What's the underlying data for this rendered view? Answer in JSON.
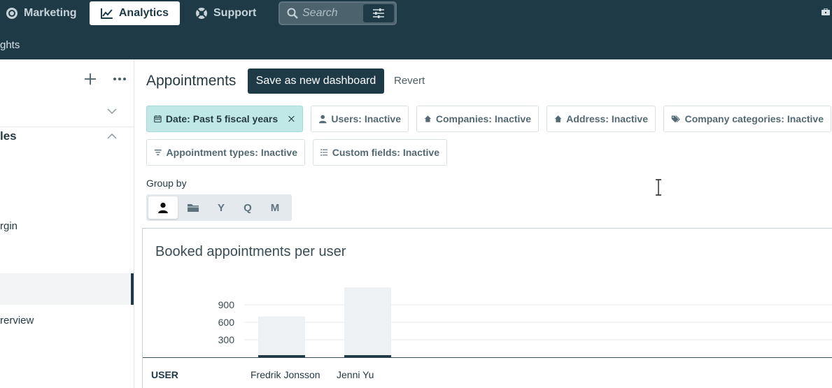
{
  "topnav": {
    "tabs": [
      {
        "label": "Marketing",
        "icon": "target-icon",
        "active": false
      },
      {
        "label": "Analytics",
        "icon": "line-chart-icon",
        "active": true
      },
      {
        "label": "Support",
        "icon": "lifebuoy-icon",
        "active": false
      }
    ],
    "search": {
      "placeholder": "Search",
      "value": ""
    },
    "subnav_label": "ghts"
  },
  "sidebar": {
    "section_title": "les",
    "items": [
      {
        "label": "rgin"
      },
      {
        "label": ""
      },
      {
        "label": "rerview"
      }
    ]
  },
  "main": {
    "title": "Appointments",
    "save_label": "Save as new dashboard",
    "revert_label": "Revert",
    "filters": [
      {
        "label": "Date: Past 5 fiscal years",
        "icon": "calendar-icon",
        "active": true
      },
      {
        "label": "Users: Inactive",
        "icon": "user-icon",
        "active": false
      },
      {
        "label": "Companies: Inactive",
        "icon": "home-icon",
        "active": false
      },
      {
        "label": "Address: Inactive",
        "icon": "home-icon",
        "active": false
      },
      {
        "label": "Company categories: Inactive",
        "icon": "tags-icon",
        "active": false
      },
      {
        "label": "Appointment types: Inactive",
        "icon": "filter-icon",
        "active": false
      },
      {
        "label": "Custom fields: Inactive",
        "icon": "list-icon",
        "active": false
      }
    ],
    "group_by": {
      "label": "Group by",
      "options": [
        {
          "label": "",
          "icon": "user-icon",
          "selected": true
        },
        {
          "label": "",
          "icon": "folder-icon",
          "selected": false
        },
        {
          "label": "Y",
          "selected": false
        },
        {
          "label": "Q",
          "selected": false
        },
        {
          "label": "M",
          "selected": false
        }
      ]
    }
  },
  "chart_data": {
    "type": "bar",
    "title": "Booked appointments per user",
    "categories": [
      "Fredrik Jonsson",
      "Jenni Yu"
    ],
    "values": [
      700,
      1200
    ],
    "y_ticks": [
      300,
      600,
      900
    ],
    "ylim": [
      0,
      1200
    ],
    "table_header": "USER",
    "colors": {
      "bar": "#eef1f4",
      "bar_base": "#1e3a47",
      "grid": "#e6eaed"
    }
  }
}
